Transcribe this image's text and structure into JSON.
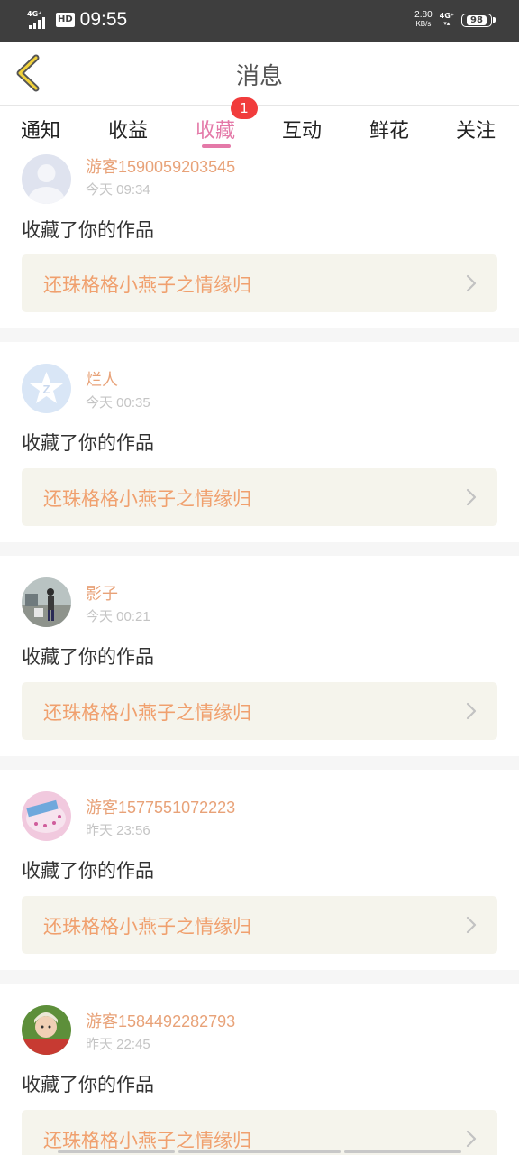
{
  "status_bar": {
    "network_left": "4G⁺",
    "hd": "HD",
    "time": "09:55",
    "speed_value": "2.80",
    "speed_unit": "KB/s",
    "network_right": "4G⁺",
    "battery": "98"
  },
  "header": {
    "title": "消息"
  },
  "tabs": [
    {
      "label": "通知"
    },
    {
      "label": "收益"
    },
    {
      "label": "收藏",
      "badge": "1"
    },
    {
      "label": "互动"
    },
    {
      "label": "鲜花"
    },
    {
      "label": "关注"
    }
  ],
  "notifications": [
    {
      "name": "游客1590059203545",
      "time": "今天 09:34",
      "action": "收藏了你的作品",
      "work": "还珠格格小燕子之情缘归"
    },
    {
      "name": "烂人",
      "time": "今天 00:35",
      "action": "收藏了你的作品",
      "work": "还珠格格小燕子之情缘归"
    },
    {
      "name": "影子",
      "time": "今天 00:21",
      "action": "收藏了你的作品",
      "work": "还珠格格小燕子之情缘归"
    },
    {
      "name": "游客1577551072223",
      "time": "昨天 23:56",
      "action": "收藏了你的作品",
      "work": "还珠格格小燕子之情缘归"
    },
    {
      "name": "游客1584492282793",
      "time": "昨天 22:45",
      "action": "收藏了你的作品",
      "work": "还珠格格小燕子之情缘归"
    }
  ],
  "colors": {
    "accent_pink": "#e479a8",
    "username_orange": "#e8a278",
    "work_title_orange": "#f0a06e",
    "badge_red": "#f13c3c",
    "work_button_bg": "#f5f4ec"
  }
}
